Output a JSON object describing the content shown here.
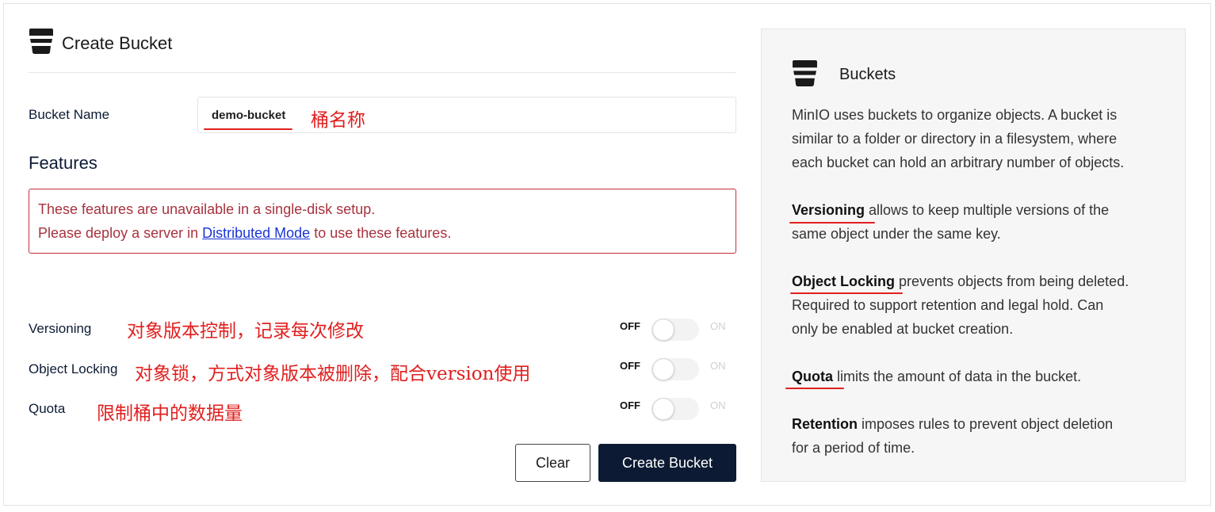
{
  "header": {
    "title": "Create Bucket",
    "icon": "bucket-icon"
  },
  "form": {
    "bucket_name_label": "Bucket Name",
    "bucket_name_value": "demo-bucket",
    "bucket_name_annotation": "桶名称",
    "features_title": "Features",
    "alert": {
      "line1": "These features are unavailable in a single-disk setup.",
      "line2_prefix": "Please deploy a server in ",
      "line2_link": "Distributed Mode",
      "line2_suffix": " to use these features."
    },
    "toggles": [
      {
        "label": "Versioning",
        "annotation": "对象版本控制，记录每次修改",
        "off_label": "OFF",
        "on_label": "ON",
        "state": "off"
      },
      {
        "label": "Object Locking",
        "annotation": "对象锁，方式对象版本被删除，配合version使用",
        "off_label": "OFF",
        "on_label": "ON",
        "state": "off"
      },
      {
        "label": "Quota",
        "annotation": "限制桶中的数据量",
        "off_label": "OFF",
        "on_label": "ON",
        "state": "off"
      }
    ],
    "clear_label": "Clear",
    "create_label": "Create Bucket"
  },
  "help": {
    "title": "Buckets",
    "icon": "bucket-icon",
    "intro_lines": [
      "MinIO uses buckets to organize objects. A bucket is",
      "similar to a folder or directory in a filesystem, where",
      "each bucket can hold an arbitrary number of objects."
    ],
    "versioning": {
      "term": "Versioning",
      "line1": " allows to keep multiple versions of the",
      "line2": "same object under the same key."
    },
    "object_locking": {
      "term": "Object Locking",
      "line1": " prevents objects from being deleted.",
      "line2": "Required to support retention and legal hold. Can",
      "line3": "only be enabled at bucket creation."
    },
    "quota": {
      "term": "Quota",
      "line1": " limits the amount of data in the bucket."
    },
    "retention": {
      "term": "Retention",
      "line1": " imposes rules to prevent object deletion",
      "line2": "for a period of time."
    }
  },
  "colors": {
    "primary": "#0c1b33",
    "alert_border": "#c2303f",
    "alert_text": "#a8323e",
    "annotation": "#e0201f",
    "link": "#1a33d6"
  }
}
